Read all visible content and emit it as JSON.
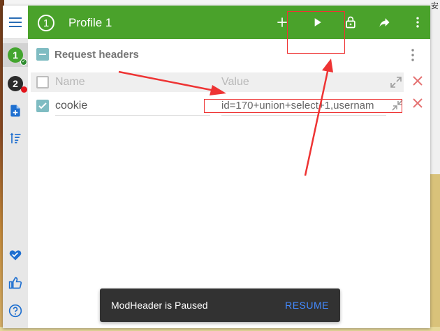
{
  "background": {
    "edge_char": "安"
  },
  "sidebar": {
    "profiles": [
      {
        "label": "1",
        "color": "#43a52e"
      },
      {
        "label": "2",
        "color": "#2b2b2b"
      }
    ]
  },
  "header": {
    "profile_number": "1",
    "title": "Profile 1",
    "color": "#4aa22b",
    "icons": [
      "add-icon",
      "play-icon",
      "lock-icon",
      "share-icon",
      "more-vert-icon"
    ]
  },
  "request_headers": {
    "section_title": "Request headers",
    "name_placeholder": "Name",
    "value_placeholder": "Value",
    "rows": [
      {
        "enabled": true,
        "name": "cookie",
        "value": "id=170+union+select+1,usernam"
      }
    ]
  },
  "snackbar": {
    "message": "ModHeader is Paused",
    "action": "RESUME"
  },
  "colors": {
    "accent": "#4aa22b",
    "checkbox": "#7fbcc2",
    "delete": "#e57373",
    "annotation": "#e33333",
    "snackbar_action": "#448aff"
  }
}
